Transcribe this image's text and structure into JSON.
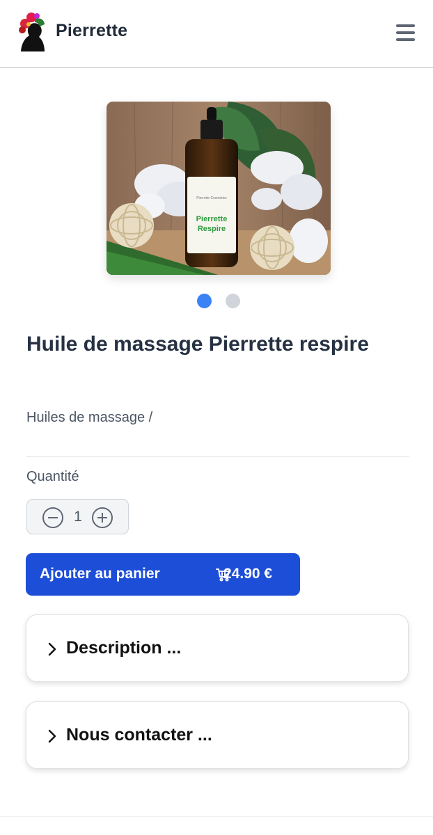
{
  "header": {
    "brand": "Pierrette",
    "logo_icon": "woman-silhouette-flower-logo",
    "menu_icon": "hamburger-menu-icon"
  },
  "product": {
    "image_label_line1": "Pierrette",
    "image_label_line2": "Respire",
    "image_small_text": "Pierrette Cosmetics",
    "carousel": {
      "count": 2,
      "active_index": 0
    },
    "title": "Huile de massage Pierrette respire",
    "breadcrumb": "Huiles de massage /"
  },
  "quantity": {
    "label": "Quantité",
    "value": "1"
  },
  "cart": {
    "label": "Ajouter au panier",
    "price": "24.90 €"
  },
  "accordions": [
    {
      "label": "Description ..."
    },
    {
      "label": "Nous contacter ..."
    }
  ],
  "colors": {
    "accent": "#1d4ed8",
    "dot_active": "#3b82f6",
    "dot_inactive": "#d1d5db"
  }
}
